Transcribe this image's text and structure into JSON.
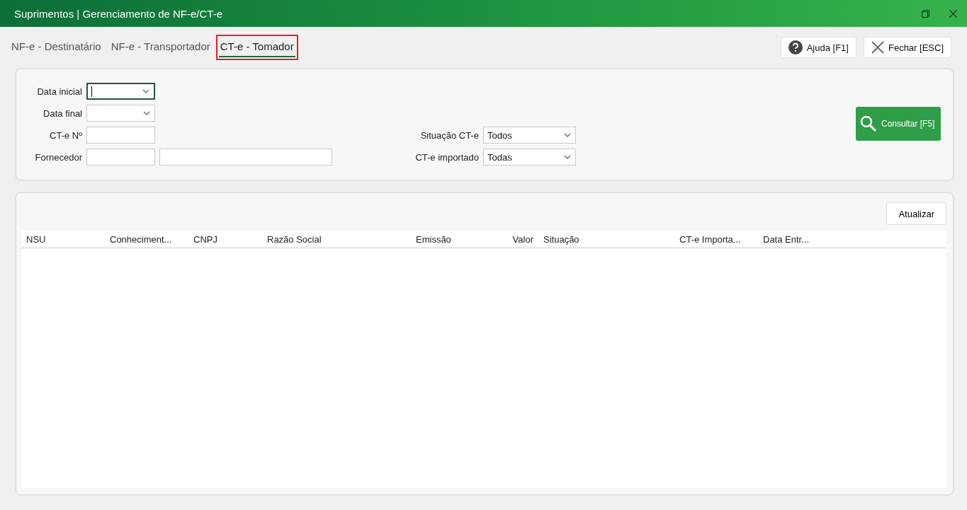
{
  "window": {
    "title": "Suprimentos | Gerenciamento de NF-e/CT-e"
  },
  "tabs": [
    {
      "label": "NF-e - Destinatário",
      "selected": false,
      "highlighted": false
    },
    {
      "label": "NF-e - Transportador",
      "selected": false,
      "highlighted": false
    },
    {
      "label": "CT-e - Tomador",
      "selected": true,
      "highlighted": true
    }
  ],
  "header_buttons": [
    {
      "kind": "help",
      "label": "Ajuda [F1]"
    },
    {
      "kind": "close",
      "label": "Fechar [ESC]"
    }
  ],
  "filters": {
    "left": [
      {
        "label": "Data inicial",
        "kind": "date",
        "focused": true
      },
      {
        "label": "Data final",
        "kind": "date",
        "focused": false
      },
      {
        "label": "CT-e Nº",
        "kind": "text",
        "focused": false
      },
      {
        "label": "Fornecedor",
        "kind": "pair",
        "focused": false
      }
    ],
    "right": [
      {
        "label": "Situação CT-e",
        "value": "Todos"
      },
      {
        "label": "CT-e importado",
        "value": "Todas"
      }
    ],
    "search_button": "Consultar [F5]"
  },
  "refresh_button": "Atualizar",
  "table": {
    "columns": [
      {
        "label": "NSU",
        "right_aligned": false
      },
      {
        "label": "Conheciment...",
        "right_aligned": false
      },
      {
        "label": "CNPJ",
        "right_aligned": false
      },
      {
        "label": "Razão Social",
        "right_aligned": false
      },
      {
        "label": "Emissão",
        "right_aligned": false
      },
      {
        "label": "Valor",
        "right_aligned": true
      },
      {
        "label": "Situação",
        "right_aligned": false
      },
      {
        "label": "CT-e Importa...",
        "right_aligned": false
      },
      {
        "label": "Data Entr...",
        "right_aligned": false
      }
    ]
  }
}
